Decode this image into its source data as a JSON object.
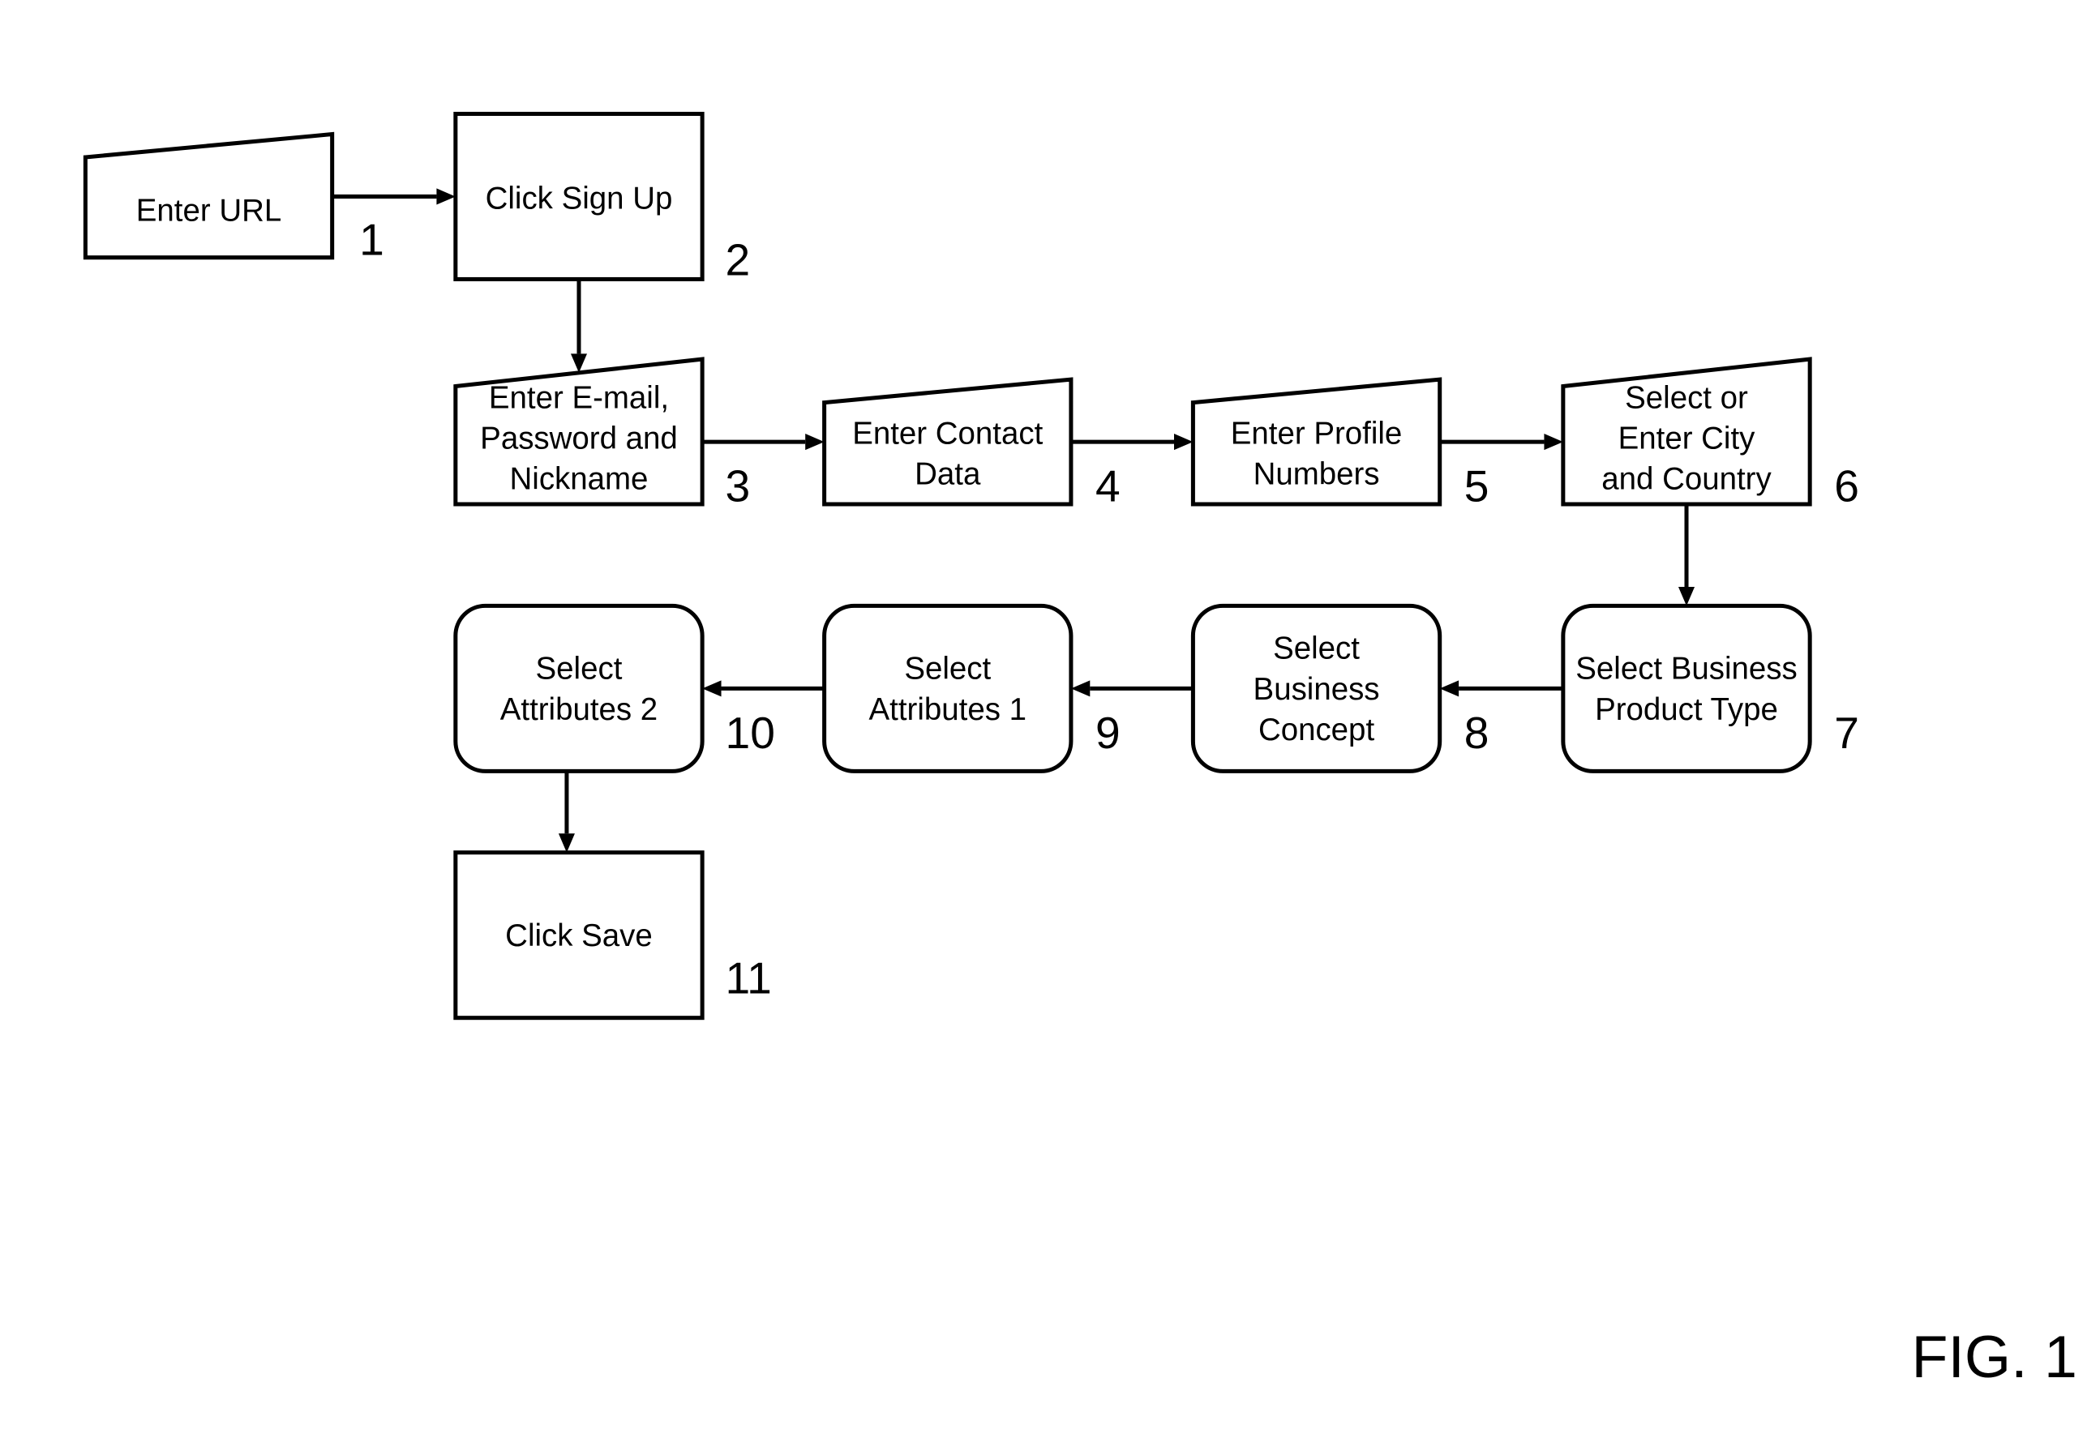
{
  "figure_label": "FIG. 1",
  "steps": [
    {
      "id": "1",
      "number": "1",
      "shape": "manual-input",
      "lines": [
        "Enter URL"
      ]
    },
    {
      "id": "2",
      "number": "2",
      "shape": "process",
      "lines": [
        "Click Sign Up"
      ]
    },
    {
      "id": "3",
      "number": "3",
      "shape": "manual-input",
      "lines": [
        "Enter E-mail,",
        "Password and",
        "Nickname"
      ]
    },
    {
      "id": "4",
      "number": "4",
      "shape": "manual-input",
      "lines": [
        "Enter Contact",
        "Data"
      ]
    },
    {
      "id": "5",
      "number": "5",
      "shape": "manual-input",
      "lines": [
        "Enter Profile",
        "Numbers"
      ]
    },
    {
      "id": "6",
      "number": "6",
      "shape": "manual-input",
      "lines": [
        "Select or",
        "Enter City",
        "and Country"
      ]
    },
    {
      "id": "7",
      "number": "7",
      "shape": "rounded",
      "lines": [
        "Select Business",
        "Product Type"
      ]
    },
    {
      "id": "8",
      "number": "8",
      "shape": "rounded",
      "lines": [
        "Select",
        "Business",
        "Concept"
      ]
    },
    {
      "id": "9",
      "number": "9",
      "shape": "rounded",
      "lines": [
        "Select",
        "Attributes 1"
      ]
    },
    {
      "id": "10",
      "number": "10",
      "shape": "rounded",
      "lines": [
        "Select",
        "Attributes 2"
      ]
    },
    {
      "id": "11",
      "number": "11",
      "shape": "process",
      "lines": [
        "Click Save"
      ]
    }
  ],
  "edges": [
    [
      "1",
      "2"
    ],
    [
      "2",
      "3"
    ],
    [
      "3",
      "4"
    ],
    [
      "4",
      "5"
    ],
    [
      "5",
      "6"
    ],
    [
      "6",
      "7"
    ],
    [
      "7",
      "8"
    ],
    [
      "8",
      "9"
    ],
    [
      "9",
      "10"
    ],
    [
      "10",
      "11"
    ]
  ]
}
